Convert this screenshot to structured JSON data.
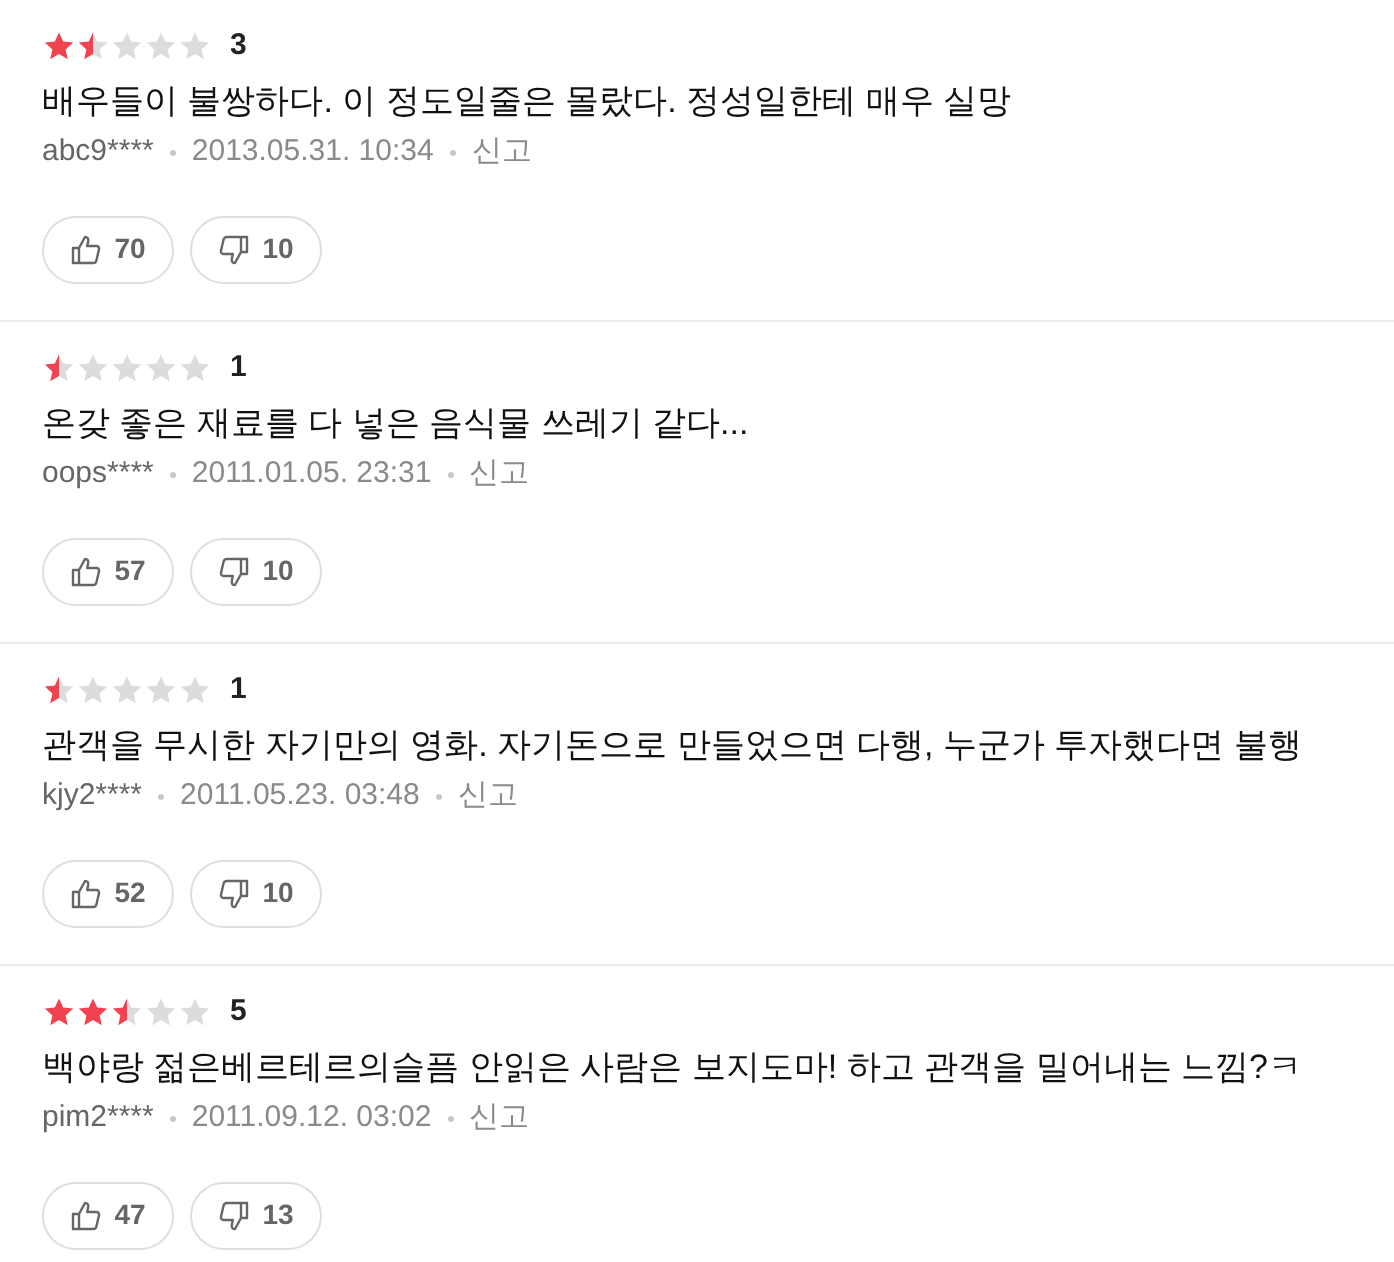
{
  "reviews": [
    {
      "stars": 1.5,
      "score": "3",
      "text": "배우들이 불쌍하다. 이 정도일줄은 몰랐다. 정성일한테 매우 실망",
      "author": "abc9****",
      "date": "2013.05.31. 10:34",
      "report": "신고",
      "likes": "70",
      "dislikes": "10"
    },
    {
      "stars": 0.5,
      "score": "1",
      "text": "온갖 좋은 재료를 다 넣은 음식물 쓰레기 같다...",
      "author": "oops****",
      "date": "2011.01.05. 23:31",
      "report": "신고",
      "likes": "57",
      "dislikes": "10"
    },
    {
      "stars": 0.5,
      "score": "1",
      "text": "관객을 무시한 자기만의 영화. 자기돈으로 만들었으면 다행, 누군가 투자했다면 불행",
      "author": "kjy2****",
      "date": "2011.05.23. 03:48",
      "report": "신고",
      "likes": "52",
      "dislikes": "10"
    },
    {
      "stars": 2.5,
      "score": "5",
      "text": "백야랑 젊은베르테르의슬픔 안읽은 사람은 보지도마! 하고 관객을 밀어내는 느낌?ㅋ",
      "author": "pim2****",
      "date": "2011.09.12. 03:02",
      "report": "신고",
      "likes": "47",
      "dislikes": "13"
    }
  ]
}
